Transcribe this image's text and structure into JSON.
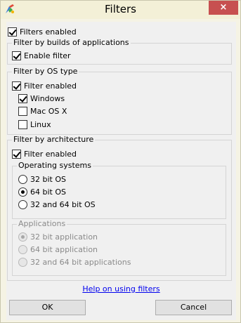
{
  "window": {
    "title": "Filters",
    "close_glyph": "×"
  },
  "filters_enabled": {
    "label": "Filters enabled",
    "checked": true
  },
  "builds_group": {
    "title": "Filter by builds of applications",
    "enable_filter": {
      "label": "Enable filter",
      "checked": true
    }
  },
  "os_group": {
    "title": "Filter by OS type",
    "filter_enabled": {
      "label": "Filter enabled",
      "checked": true
    },
    "options": [
      {
        "label": "Windows",
        "checked": true
      },
      {
        "label": "Mac OS X",
        "checked": false
      },
      {
        "label": "Linux",
        "checked": false
      }
    ]
  },
  "arch_group": {
    "title": "Filter by architecture",
    "filter_enabled": {
      "label": "Filter enabled",
      "checked": true
    },
    "os_subgroup": {
      "title": "Operating systems",
      "options": [
        {
          "label": "32 bit OS",
          "selected": false
        },
        {
          "label": "64 bit OS",
          "selected": true
        },
        {
          "label": "32 and 64 bit OS",
          "selected": false
        }
      ]
    },
    "apps_subgroup": {
      "title": "Applications",
      "options": [
        {
          "label": "32 bit application",
          "selected": true
        },
        {
          "label": "64 bit application",
          "selected": false
        },
        {
          "label": "32 and 64 bit applications",
          "selected": false
        }
      ]
    }
  },
  "help_link": "Help on using filters",
  "buttons": {
    "ok": "OK",
    "cancel": "Cancel"
  }
}
